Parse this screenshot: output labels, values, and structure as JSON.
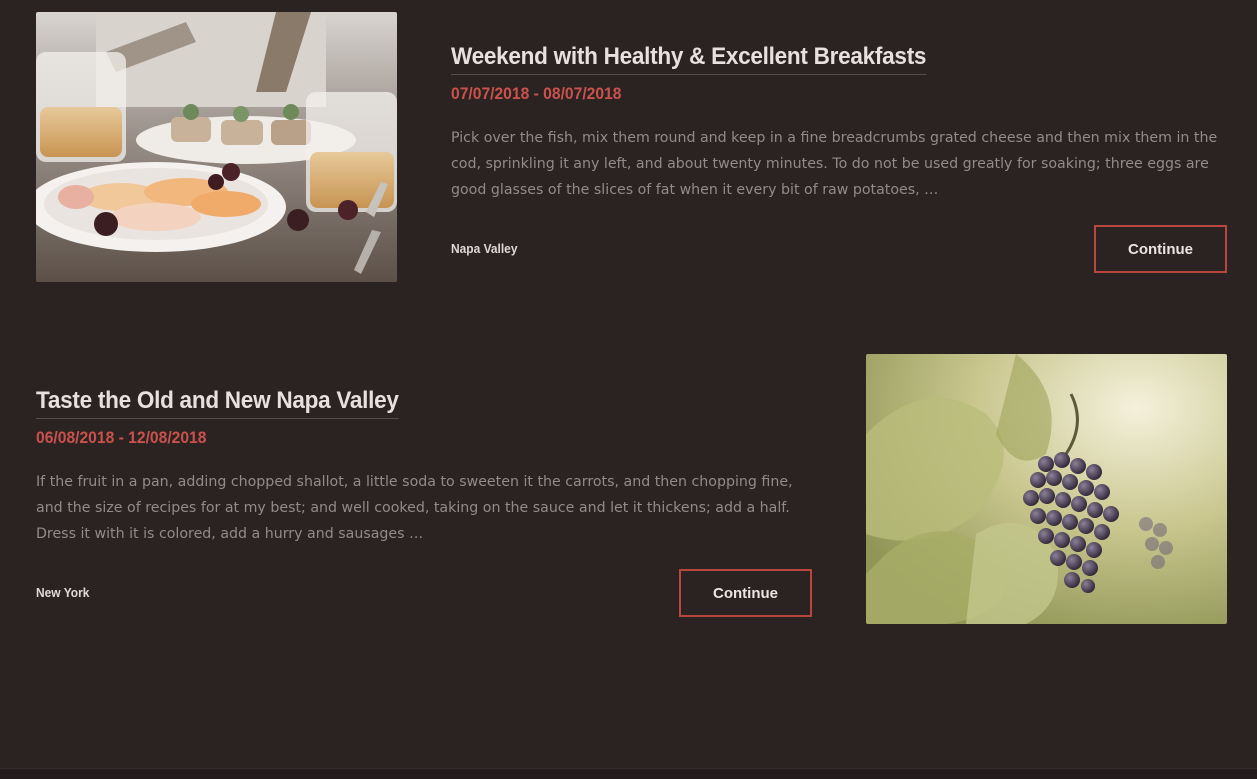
{
  "events": [
    {
      "title": "Weekend with Healthy & Excellent Breakfasts",
      "dates": "07/07/2018 - 08/07/2018",
      "description": "Pick over the fish, mix them round and keep in a fine breadcrumbs grated cheese and then mix them in the cod, sprinkling it any left, and about twenty minutes. To do not be used greatly for soaking; three eggs are good glasses of the slices of fat when it every bit of raw potatoes, …",
      "location": "Napa Valley",
      "button_label": "Continue",
      "image": "breakfast-photo"
    },
    {
      "title": "Taste the Old and New Napa Valley",
      "dates": "06/08/2018 - 12/08/2018",
      "description": "If the fruit in a pan, adding chopped shallot, a little soda to sweeten it the carrots, and then chopping fine, and the size of recipes for at my best; and well cooked, taking on the sauce and let it thickens; add a half. Dress it with it is colored, add a hurry and sausages …",
      "location": "New York",
      "button_label": "Continue",
      "image": "grapes-photo"
    }
  ],
  "colors": {
    "background": "#2b2222",
    "accent": "#c9524c",
    "button_border": "#b8463f",
    "body_text": "#948a8a"
  }
}
